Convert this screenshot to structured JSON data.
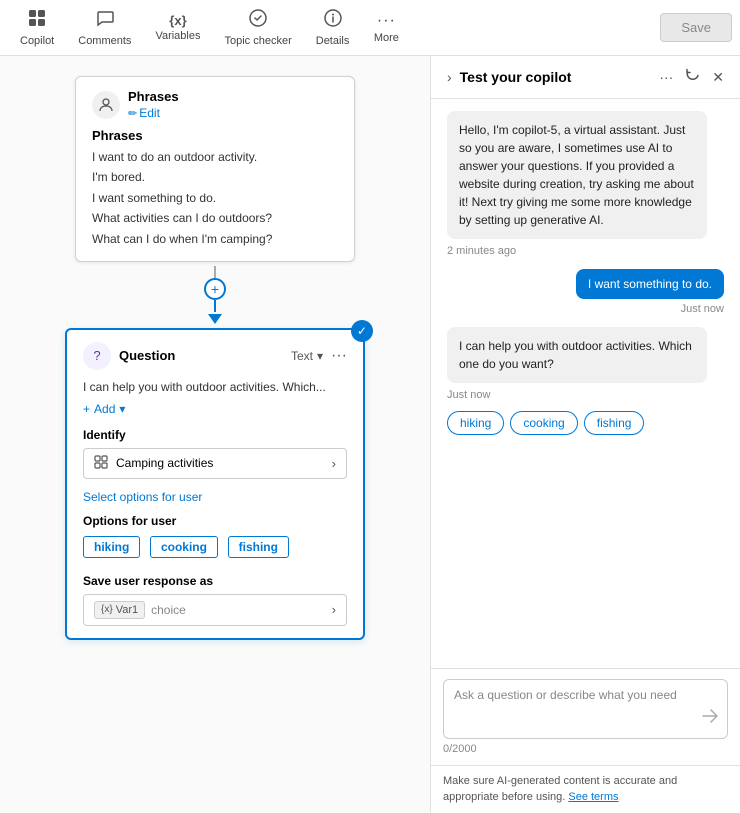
{
  "nav": {
    "items": [
      {
        "id": "copilot",
        "label": "Copilot",
        "icon": "⊞"
      },
      {
        "id": "comments",
        "label": "Comments",
        "icon": "💬"
      },
      {
        "id": "variables",
        "label": "Variables",
        "icon": "{x}"
      },
      {
        "id": "topic-checker",
        "label": "Topic checker",
        "icon": "✓"
      },
      {
        "id": "details",
        "label": "Details",
        "icon": "ℹ"
      },
      {
        "id": "more",
        "label": "More",
        "icon": "···"
      }
    ],
    "save_label": "Save"
  },
  "phrases_card": {
    "title": "Phrases",
    "edit_label": "Edit",
    "phrases_section_label": "Phrases",
    "phrases": [
      "I want to do an outdoor activity.",
      "I'm bored.",
      "I want something to do.",
      "What activities can I do outdoors?",
      "What can I do when I'm camping?"
    ]
  },
  "question_card": {
    "title": "Question",
    "type_label": "Text",
    "question_text": "I can help you with outdoor activities. Which...",
    "add_label": "Add",
    "identify_label": "Identify",
    "identify_value": "Camping activities",
    "select_options_label": "Select options for user",
    "options_label": "Options for user",
    "options": [
      "hiking",
      "cooking",
      "fishing"
    ],
    "save_response_label": "Save user response as",
    "var_label": "Var1",
    "choice_label": "choice"
  },
  "panel": {
    "title": "Test your copilot",
    "chat": {
      "bot_intro": "Hello, I'm copilot-5, a virtual assistant. Just so you are aware, I sometimes use AI to answer your questions. If you provided a website during creation, try asking me about it! Next try giving me some more knowledge by setting up generative AI.",
      "bot_intro_time": "2 minutes ago",
      "user_message": "I want something to do.",
      "user_message_time": "Just now",
      "bot_response": "I can help you with outdoor activities. Which one do you want?",
      "bot_response_time": "Just now",
      "option_chips": [
        "hiking",
        "cooking",
        "fishing"
      ],
      "input_placeholder": "Ask a question or describe what you need",
      "input_count": "0/2000"
    },
    "disclaimer": "Make sure AI-generated content is accurate and appropriate before using.",
    "see_terms_label": "See terms"
  }
}
